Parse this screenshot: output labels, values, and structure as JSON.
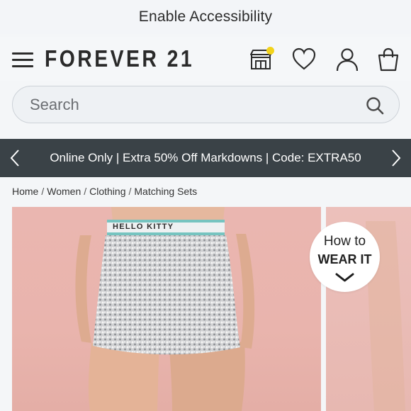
{
  "accessibility_bar": {
    "label": "Enable Accessibility"
  },
  "header": {
    "logo": "FOREVER 21",
    "icons": [
      "menu-icon",
      "store-icon",
      "heart-icon",
      "user-icon",
      "bag-icon"
    ],
    "store_badge_color": "#f2d31b"
  },
  "search": {
    "placeholder": "Search"
  },
  "promo": {
    "text": "Online Only | Extra 50% Off Markdowns | Code: EXTRA50",
    "background": "#3a4247"
  },
  "breadcrumb": [
    "Home",
    "Women",
    "Clothing",
    "Matching Sets"
  ],
  "product": {
    "waistband_text": "HELLO KITTY",
    "how_to": {
      "line1": "How to",
      "line2": "WEAR IT"
    }
  }
}
